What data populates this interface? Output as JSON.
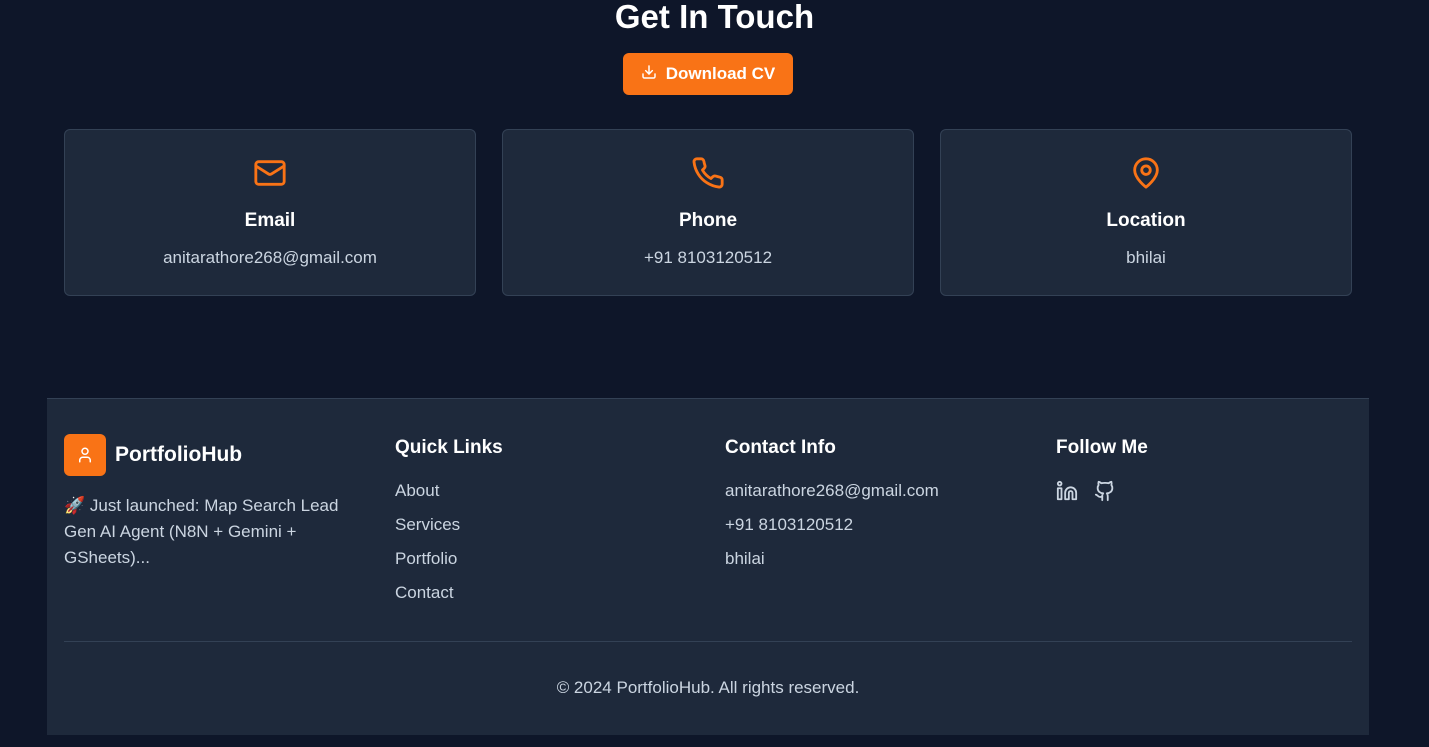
{
  "contact": {
    "title": "Get In Touch",
    "download_label": "Download CV",
    "cards": [
      {
        "icon": "mail-icon",
        "title": "Email",
        "value": "anitarathore268@gmail.com"
      },
      {
        "icon": "phone-icon",
        "title": "Phone",
        "value": "+91 8103120512"
      },
      {
        "icon": "map-pin-icon",
        "title": "Location",
        "value": "bhilai"
      }
    ]
  },
  "footer": {
    "brand_name": "PortfolioHub",
    "brand_description": "🚀 Just launched: Map Search Lead Gen AI Agent (N8N + Gemini + GSheets)...",
    "quick_links": {
      "title": "Quick Links",
      "items": [
        "About",
        "Services",
        "Portfolio",
        "Contact"
      ]
    },
    "contact_info": {
      "title": "Contact Info",
      "items": [
        "anitarathore268@gmail.com",
        "+91 8103120512",
        "bhilai"
      ]
    },
    "follow": {
      "title": "Follow Me",
      "icons": [
        "linkedin-icon",
        "github-icon"
      ]
    },
    "copyright": "© 2024 PortfolioHub. All rights reserved."
  },
  "colors": {
    "accent": "#f97316",
    "background": "#0e1629",
    "card": "#1e293b"
  }
}
